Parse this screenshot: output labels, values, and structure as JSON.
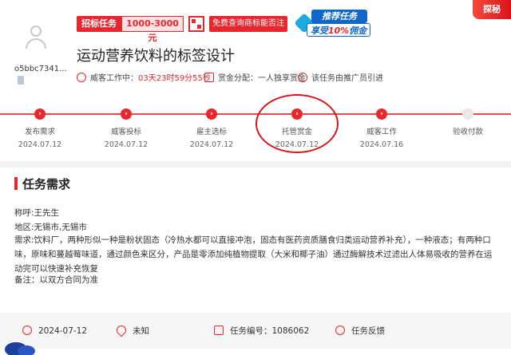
{
  "header": {
    "username": "o5bbc7341...",
    "task_type_label": "招标任务",
    "budget": "1000-3000元",
    "query_button_label": "免费查询商标能否注册",
    "promo_line1": "推荐任务",
    "promo_line2_prefix": "享受",
    "promo_line2_highlight": "10%",
    "promo_line2_suffix": "佣金",
    "corner_tag": "探秘",
    "title": "运动营养饮料的标签设计"
  },
  "meta": {
    "status_label": "威客工作中：",
    "countdown": "03天23时59分55秒",
    "reward_label": "赏金分配：一人独享赏金",
    "referral_label": "该任务由推广员引进"
  },
  "steps": [
    {
      "label": "发布需求",
      "date": "2024.07.12",
      "done": true
    },
    {
      "label": "威客投标",
      "date": "2024.07.12",
      "done": true
    },
    {
      "label": "雇主选标",
      "date": "2024.07.12",
      "done": true
    },
    {
      "label": "托管赏金",
      "date": "2024.07.12",
      "done": true
    },
    {
      "label": "威客工作",
      "date": "2024.07.16",
      "done": true
    },
    {
      "label": "验收付款",
      "date": "",
      "done": false
    }
  ],
  "requirement": {
    "section_title": "任务需求",
    "name": "称呼:王先生",
    "region": "地区:无锡市,无锡市",
    "description": "需求:饮料厂，两种形似一种是粉状固态（冷热水都可以直接冲泡，固态有医药资质膳食归类运动营养补充），一种液态；有两种口味，原味和蔓越莓味道，通过颜色来区分，产品是零添加纯植物提取（大米和椰子油）通过酶解技术过滤出人体易吸收的营养在运动完可以快速补充恢复",
    "note": "备注：以双方合同为准"
  },
  "footer": {
    "date": "2024-07-12",
    "location": "未知",
    "task_number": "任务编号：1086062",
    "feedback": "任务反馈"
  },
  "colors": {
    "accent": "#e8262d",
    "promo_blue": "#0f67c8",
    "muted": "#e7e7e7"
  }
}
